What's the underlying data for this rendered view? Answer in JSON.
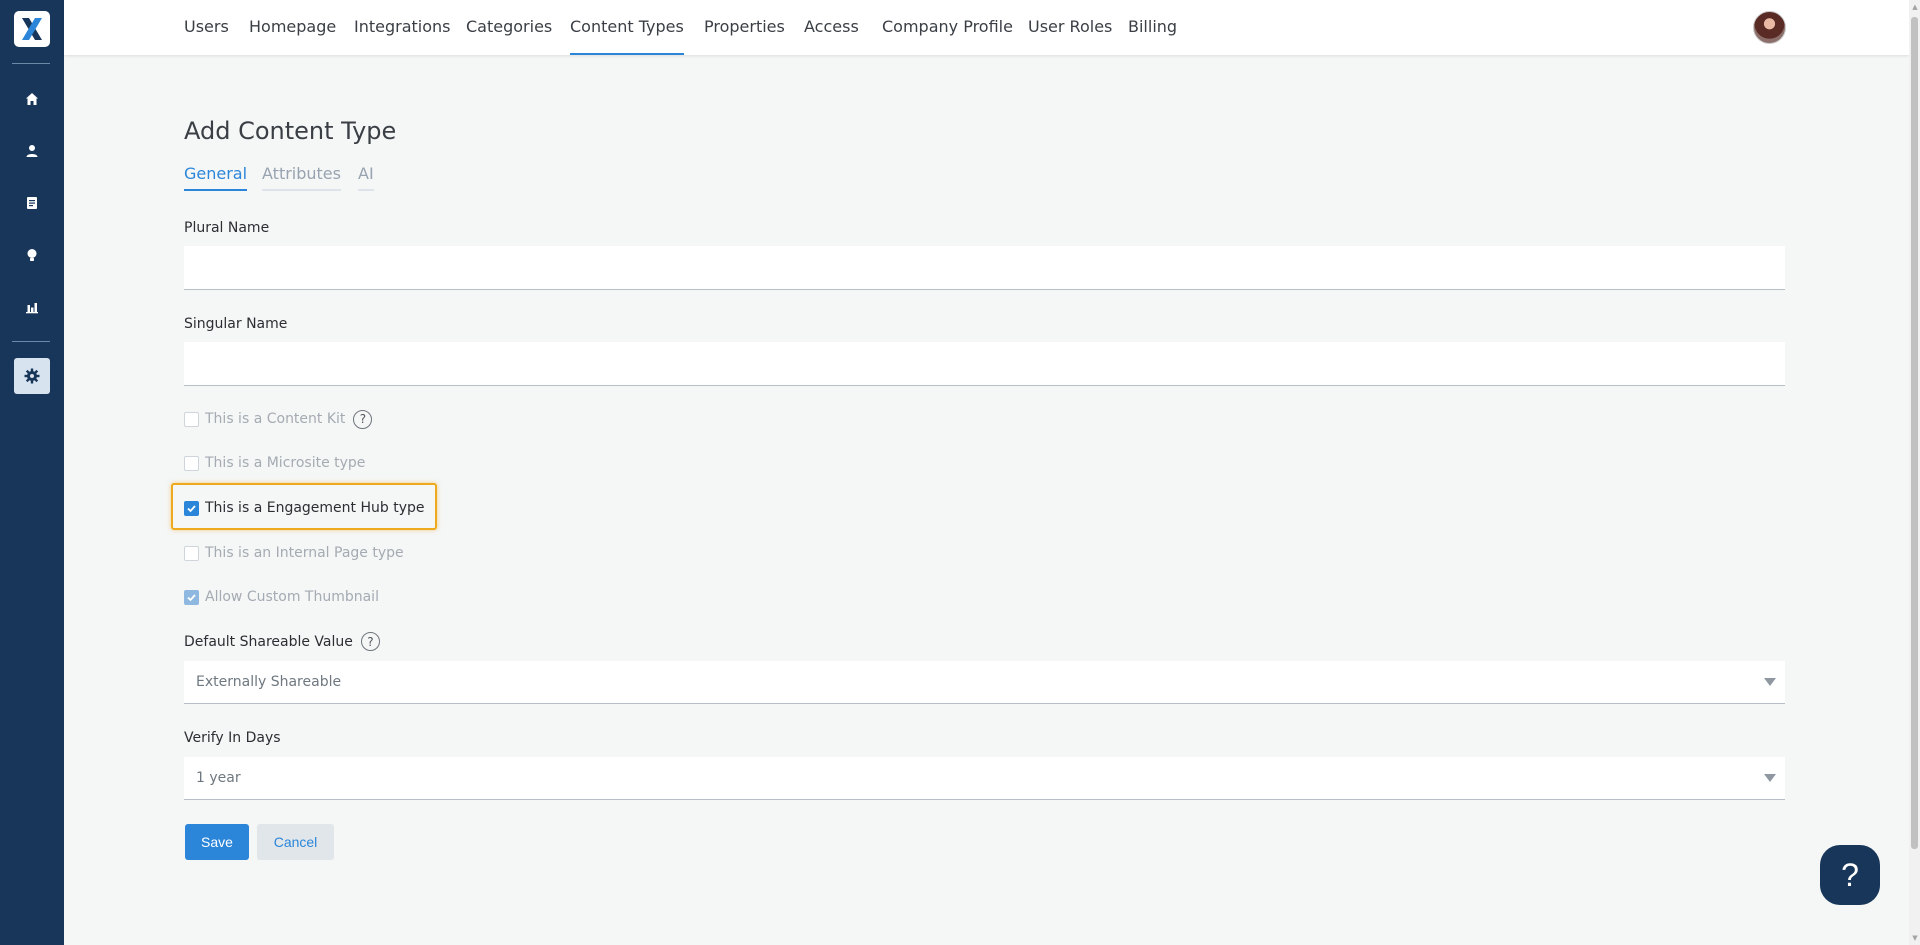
{
  "rail": {
    "logo_icon": "x-logo-icon",
    "items": [
      {
        "icon": "home-icon"
      },
      {
        "icon": "user-icon"
      },
      {
        "icon": "document-icon"
      },
      {
        "icon": "lightbulb-icon"
      },
      {
        "icon": "bar-chart-icon"
      },
      {
        "icon": "gear-icon",
        "active": true
      }
    ]
  },
  "topnav": {
    "tabs": [
      {
        "label": "Users"
      },
      {
        "label": "Homepage"
      },
      {
        "label": "Integrations"
      },
      {
        "label": "Categories"
      },
      {
        "label": "Content Types",
        "active": true
      },
      {
        "label": "Properties"
      },
      {
        "label": "Access"
      },
      {
        "label": "Company Profile"
      },
      {
        "label": "User Roles"
      },
      {
        "label": "Billing"
      }
    ]
  },
  "page": {
    "title": "Add Content Type",
    "subtabs": [
      {
        "label": "General",
        "active": true
      },
      {
        "label": "Attributes"
      },
      {
        "label": "AI"
      }
    ]
  },
  "form": {
    "plural_name": {
      "label": "Plural Name",
      "value": ""
    },
    "singular_name": {
      "label": "Singular Name",
      "value": ""
    },
    "checkboxes": [
      {
        "label": "This is a Content Kit",
        "checked": false,
        "disabled": true,
        "help": true
      },
      {
        "label": "This is a Microsite type",
        "checked": false,
        "disabled": true
      },
      {
        "label": "This is a Engagement Hub type",
        "checked": true,
        "disabled": false
      },
      {
        "label": "This is an Internal Page type",
        "checked": false,
        "disabled": true
      },
      {
        "label": "Allow Custom Thumbnail",
        "checked": true,
        "disabled": true
      }
    ],
    "default_shareable": {
      "label": "Default Shareable Value",
      "value": "Externally Shareable"
    },
    "verify_in_days": {
      "label": "Verify In Days",
      "value": "1 year"
    },
    "save_label": "Save",
    "cancel_label": "Cancel"
  },
  "help_fab": {
    "label": "?"
  },
  "help_icon_glyph": "?",
  "colors": {
    "rail": "#17365a",
    "accent": "#2b86d9",
    "highlight": "#eeaa1c"
  }
}
